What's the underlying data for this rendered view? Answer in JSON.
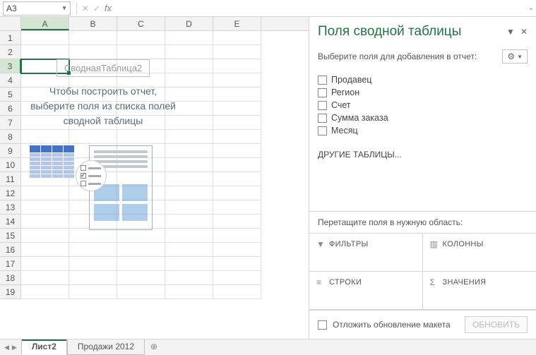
{
  "formula_bar": {
    "name_box": "A3",
    "formula": ""
  },
  "grid": {
    "columns": [
      "A",
      "B",
      "C",
      "D",
      "E"
    ],
    "rows": [
      "1",
      "2",
      "3",
      "4",
      "5",
      "6",
      "7",
      "8",
      "9",
      "10",
      "11",
      "12",
      "13",
      "14",
      "15",
      "16",
      "17",
      "18",
      "19"
    ],
    "selected_cell": "A3",
    "active_col": "A",
    "active_row": "3"
  },
  "pivot_placeholder": {
    "name": "СводнаяТаблица2",
    "message": "Чтобы построить отчет, выберите поля из списка полей сводной таблицы"
  },
  "sidebar": {
    "title": "Поля сводной таблицы",
    "choose_label": "Выберите поля для добавления в отчет:",
    "fields": [
      {
        "label": "Продавец"
      },
      {
        "label": "Регион"
      },
      {
        "label": "Счет"
      },
      {
        "label": "Сумма заказа"
      },
      {
        "label": "Месяц"
      }
    ],
    "other_tables": "ДРУГИЕ ТАБЛИЦЫ...",
    "drag_label": "Перетащите поля в нужную область:",
    "zones": {
      "filters": "ФИЛЬТРЫ",
      "columns": "КОЛОННЫ",
      "rows": "СТРОКИ",
      "values": "ЗНАЧЕНИЯ"
    },
    "defer_label": "Отложить обновление макета",
    "update_btn": "ОБНОВИТЬ"
  },
  "sheet_tabs": {
    "active": "Лист2",
    "tabs": [
      "Лист2",
      "Продажи 2012"
    ]
  }
}
